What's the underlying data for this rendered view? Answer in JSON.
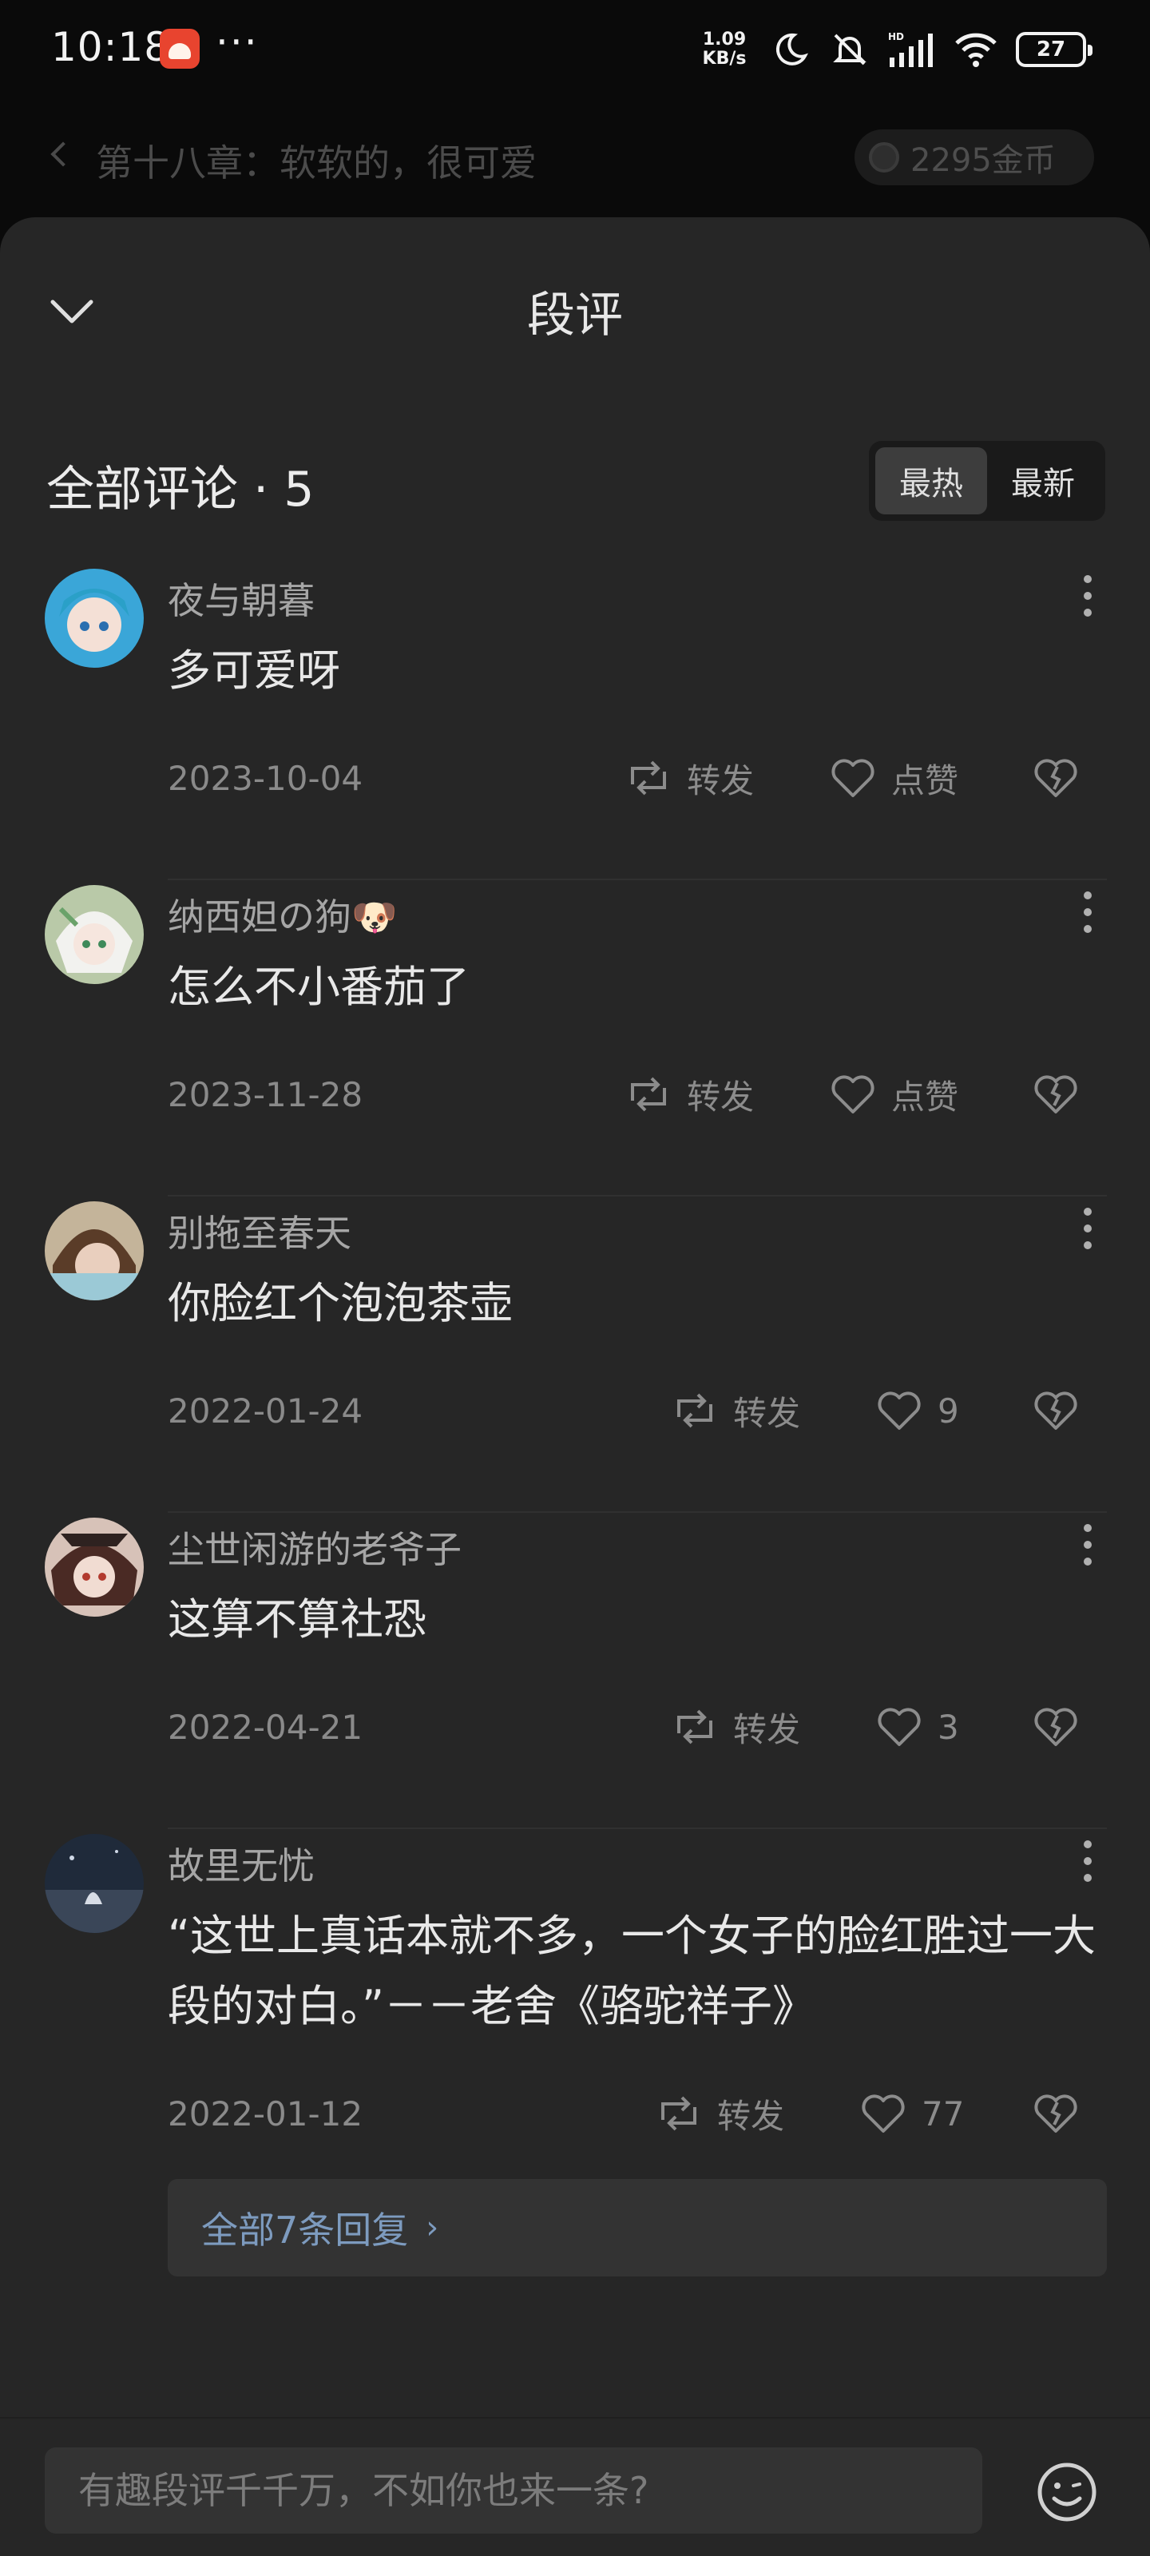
{
  "status_bar": {
    "time": "10:18",
    "more": "···",
    "speed_value": "1.09",
    "speed_unit": "KB/s",
    "battery": "27",
    "signal_label": "HD"
  },
  "reader": {
    "chapter_title": "第十八章：软软的，很可爱",
    "coins": "2295金币"
  },
  "panel": {
    "title": "段评",
    "all_comments_label": "全部评论 · 5",
    "sort": {
      "hot": "最热",
      "new": "最新"
    }
  },
  "comments": [
    {
      "user": "夜与朝暮",
      "text": "多可爱呀",
      "date": "2023-10-04",
      "repost_label": "转发",
      "like_label": "点赞"
    },
    {
      "user": "纳西妲の狗🐶",
      "text": "怎么不小番茄了",
      "date": "2023-11-28",
      "repost_label": "转发",
      "like_label": "点赞"
    },
    {
      "user": "别拖至春天",
      "text": "你脸红个泡泡茶壶",
      "date": "2022-01-24",
      "repost_label": "转发",
      "like_label": "9"
    },
    {
      "user": "尘世闲游的老爷子",
      "text": "这算不算社恐",
      "date": "2022-04-21",
      "repost_label": "转发",
      "like_label": "3"
    },
    {
      "user": "故里无忧",
      "text": "“这世上真话本就不多，一个女子的脸红胜过一大段的对白。”－－老舍《骆驼祥子》",
      "date": "2022-01-12",
      "repost_label": "转发",
      "like_label": "77",
      "replies_label": "全部7条回复",
      "replies_chevron": "›"
    }
  ],
  "input": {
    "placeholder": "有趣段评千千万，不如你也来一条?"
  },
  "colors": {
    "panel_bg": "#262626",
    "link_blue": "#7d9bbf",
    "text_primary": "#e8e8e8",
    "text_secondary": "#8a8a8a"
  }
}
